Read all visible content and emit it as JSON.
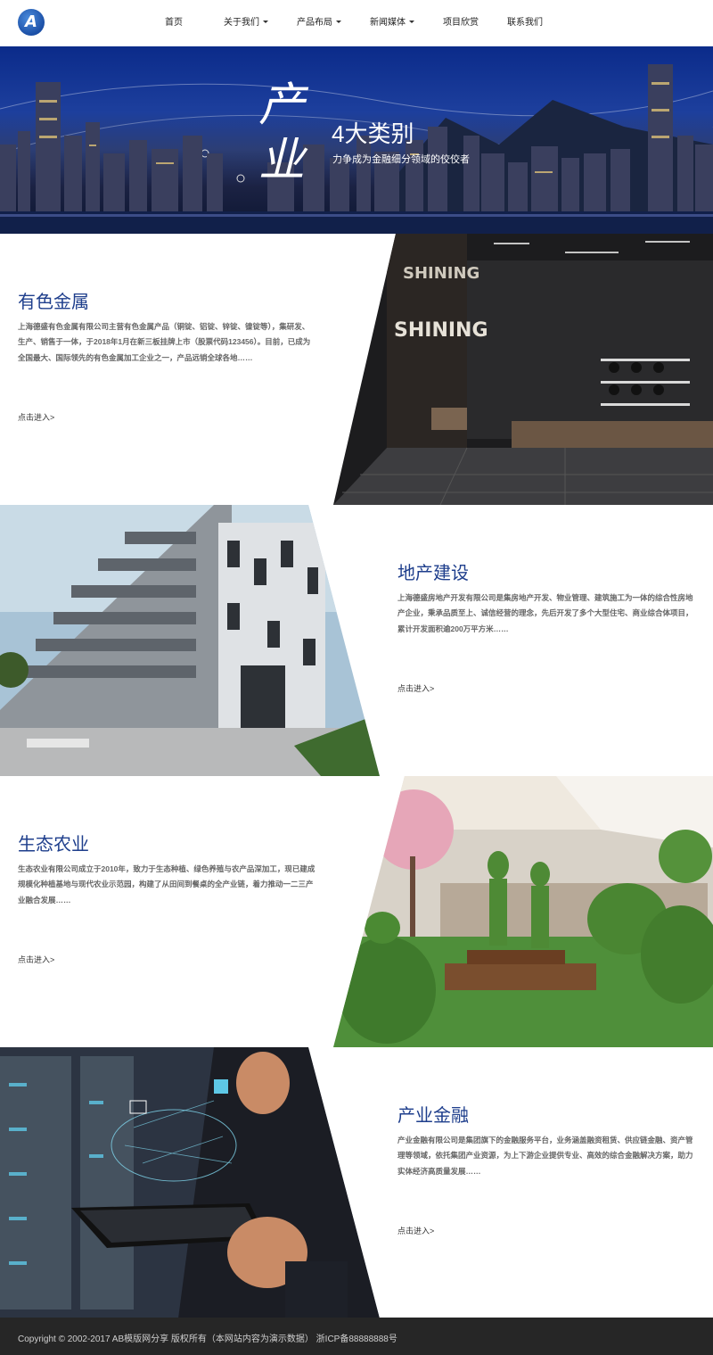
{
  "header": {
    "logo_letter": "A",
    "nav": [
      {
        "label": "首页",
        "dropdown": false
      },
      {
        "label": "关于我们",
        "dropdown": true
      },
      {
        "label": "产品布局",
        "dropdown": true
      },
      {
        "label": "新闻媒体",
        "dropdown": true
      },
      {
        "label": "项目欣赏",
        "dropdown": false
      },
      {
        "label": "联系我们",
        "dropdown": false
      }
    ]
  },
  "banner": {
    "big_char_1": "产",
    "big_char_2": "业",
    "title": "4大类别",
    "subtitle": "力争成为金融细分领域的佼佼者"
  },
  "sections": [
    {
      "title": "有色金属",
      "description": "上海德盛有色金属有限公司主营有色金属产品（铜锭、铝锭、锌锭、镍锭等），集研发、生产、销售于一体，于2018年1月在新三板挂牌上市（股票代码123456）。目前，已成为全国最大、国际领先的有色金属加工企业之一，产品远销全球各地……",
      "link": "点击进入>"
    },
    {
      "title": "地产建设",
      "description": "上海德盛房地产开发有限公司是集房地产开发、物业管理、建筑施工为一体的综合性房地产企业，秉承品质至上、诚信经营的理念，先后开发了多个大型住宅、商业综合体项目，累计开发面积逾200万平方米……",
      "link": "点击进入>"
    },
    {
      "title": "生态农业",
      "description": "生态农业有限公司成立于2010年，致力于生态种植、绿色养殖与农产品深加工，现已建成规模化种植基地与现代农业示范园，构建了从田间到餐桌的全产业链，着力推动一二三产业融合发展……",
      "link": "点击进入>"
    },
    {
      "title": "产业金融",
      "description": "产业金融有限公司是集团旗下的金融服务平台，业务涵盖融资租赁、供应链金融、资产管理等领域，依托集团产业资源，为上下游企业提供专业、高效的综合金融解决方案，助力实体经济高质量发展……",
      "link": "点击进入>"
    }
  ],
  "footer": {
    "text": "Copyright © 2002-2017 AB模版网分享 版权所有（本网站内容为演示数据） 浙ICP备88888888号"
  }
}
